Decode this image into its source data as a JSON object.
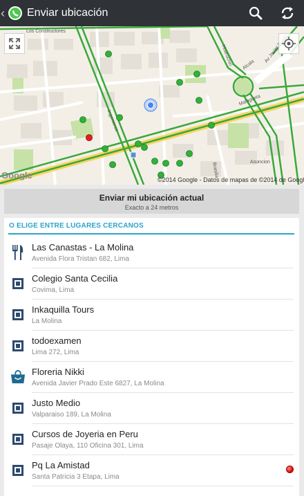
{
  "app_bar": {
    "title": "Enviar ubicación",
    "back_icon": "chevron-left-icon",
    "logo_icon": "whatsapp-logo",
    "actions": [
      {
        "icon": "search-icon"
      },
      {
        "icon": "refresh-icon"
      }
    ]
  },
  "map": {
    "attribution": "©2014 Google - Datos de mapas de ©2014 de Google",
    "google_logo": "Google",
    "streets": {
      "los_constructores": "Los Constructores",
      "javier_prado": "Av Javier Prado",
      "ingenieros": "Ingenieros",
      "alcala": "Alcala",
      "huarochiri": "Huarochiri",
      "malagueta": "Malagueta",
      "asuncion": "Asuncion",
      "brasilia": "Brasilia"
    },
    "colors": {
      "road": "#3aa83a",
      "highway": "#f7d463",
      "land": "#f3efe7",
      "park": "#c6e2a6"
    }
  },
  "current_location": {
    "title": "Enviar mi ubicación actual",
    "accuracy": "Exacto a 24 metros"
  },
  "nearby": {
    "header": "O ELIGE ENTRE LUGARES CERCANOS",
    "accent_color": "#2aa3c7",
    "places": [
      {
        "name": "Las Canastas - La Molina",
        "address": "Avenida Flora Tristan 682, Lima",
        "icon": "restaurant-icon"
      },
      {
        "name": "Colegio Santa Cecilia",
        "address": "Covima, Lima",
        "icon": "place-icon"
      },
      {
        "name": "Inkaquilla Tours",
        "address": "La Molina",
        "icon": "place-icon"
      },
      {
        "name": "todoexamen",
        "address": "Lima 272, Lima",
        "icon": "place-icon"
      },
      {
        "name": "Floreria Nikki",
        "address": "Avenida Javier Prado Este 6827, La Molina",
        "icon": "shopping-bag-icon"
      },
      {
        "name": "Justo Medio",
        "address": "Valparaiso 189, La Molina",
        "icon": "place-icon"
      },
      {
        "name": "Cursos de Joyeria en Peru",
        "address": "Pasaje Olaya, 110 Oficina 301, Lima",
        "icon": "place-icon"
      },
      {
        "name": "Pq La Amistad",
        "address": "Santa Patricia 3 Etapa, Lima",
        "icon": "place-icon",
        "marker": "red-pin"
      }
    ]
  }
}
